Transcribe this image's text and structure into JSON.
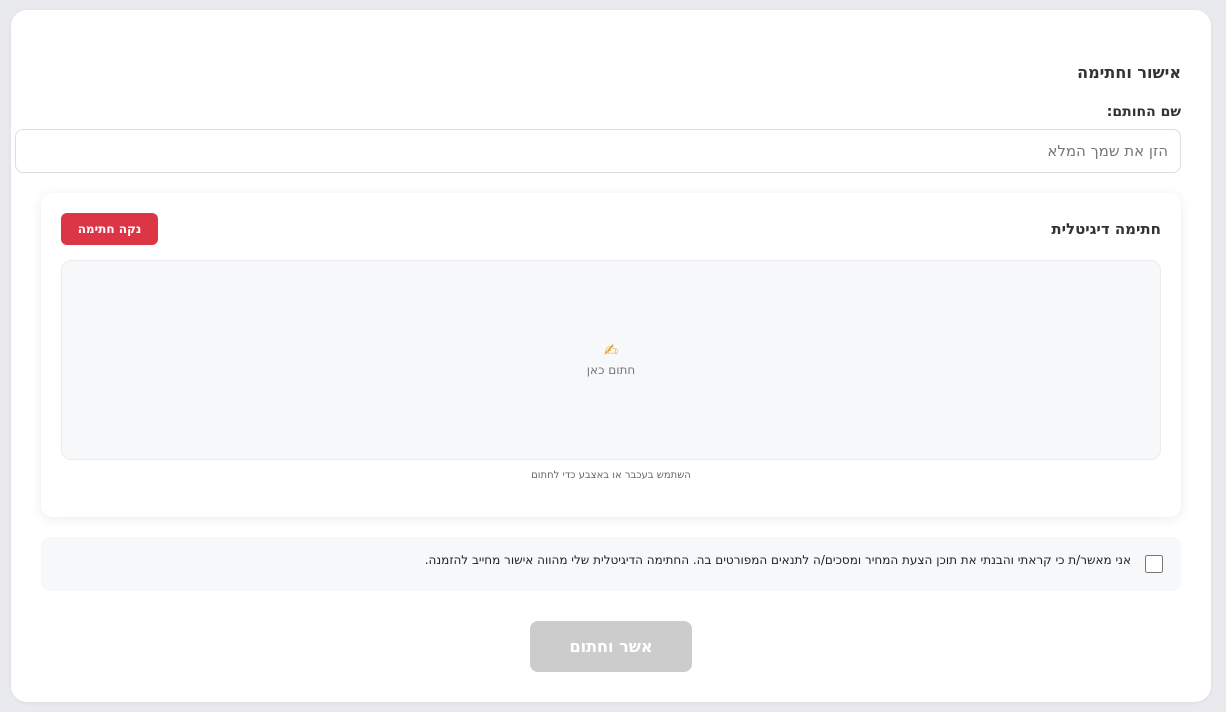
{
  "approval": {
    "title": "אישור וחתימה",
    "signer_label": "שם החותם:",
    "signer_placeholder": "הזן את שמך המלא",
    "signer_value": ""
  },
  "signature": {
    "title": "חתימה דיגיטלית",
    "clear_label": "נקה חתימה",
    "pen_icon": "✍",
    "canvas_hint": "חתום כאן",
    "helper_text": "השתמש בעכבר או באצבע כדי לחתום"
  },
  "consent": {
    "checked": false,
    "text": "אני מאשר/ת כי קראתי והבנתי את תוכן הצעת המחיר ומסכים/ה לתנאים המפורטים בה. החתימה הדיגיטלית שלי מהווה אישור מחייב להזמנה."
  },
  "submit": {
    "label": "אשר וחתום",
    "enabled": false
  },
  "colors": {
    "danger": "#dc3545",
    "disabled": "#cccccc"
  }
}
